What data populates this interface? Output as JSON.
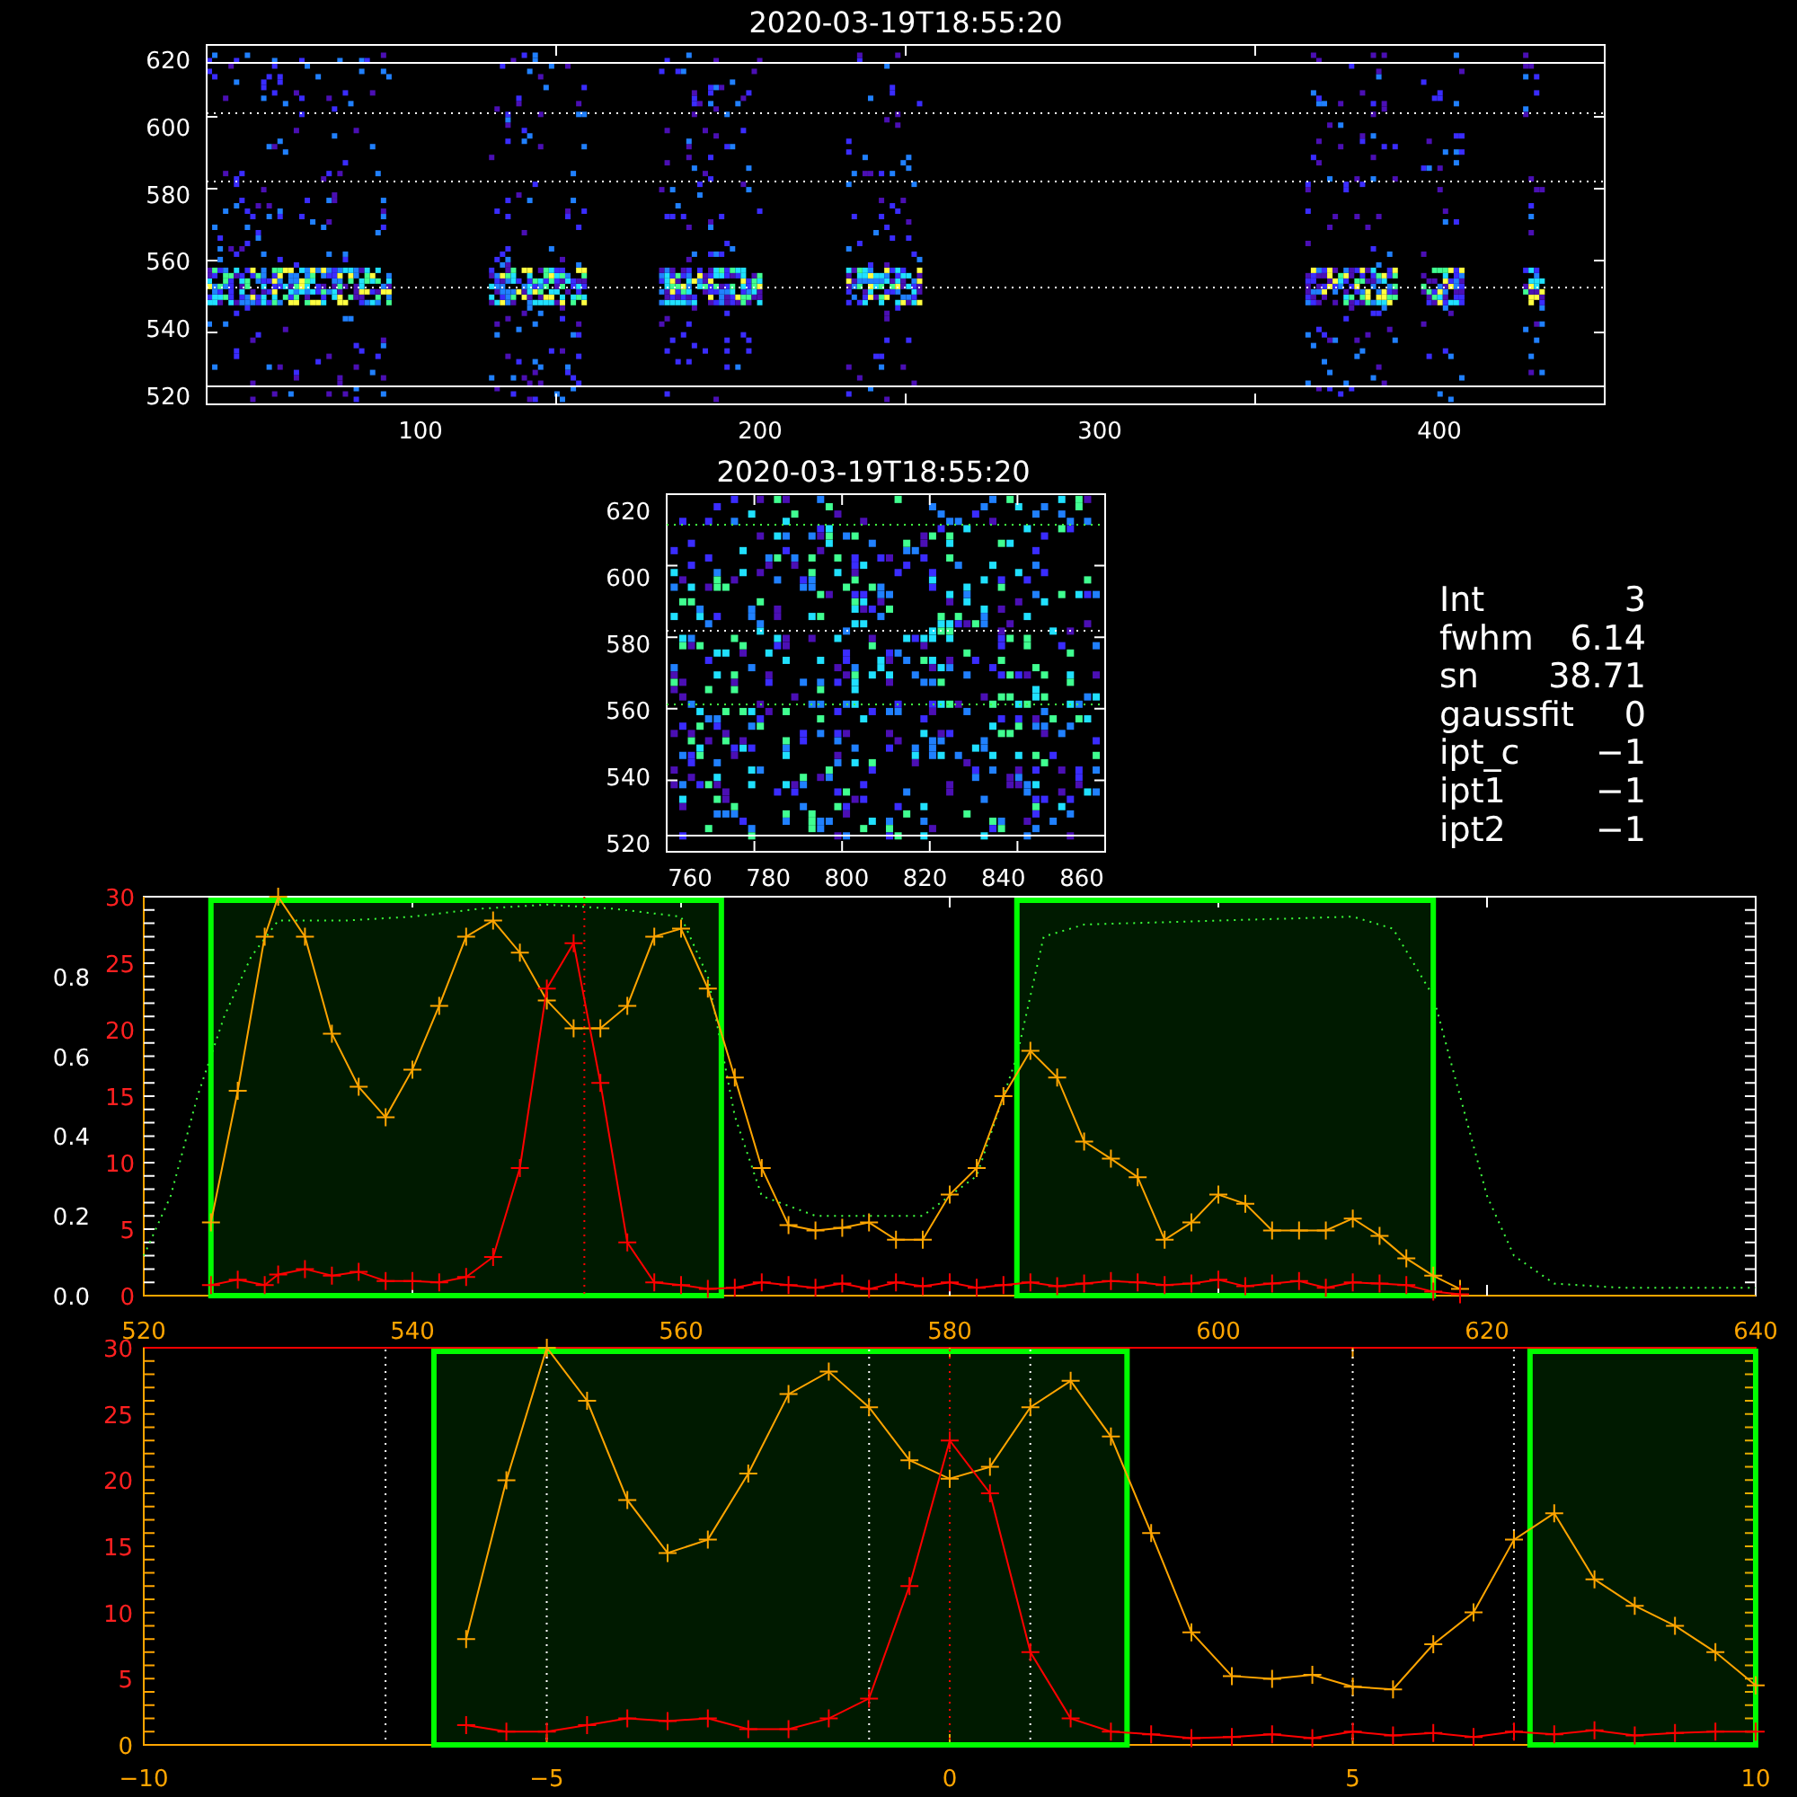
{
  "detector_image": {
    "title": "2020-03-19T18:55:20",
    "yticks": [
      "620",
      "600",
      "580",
      "560",
      "540",
      "520"
    ],
    "xticks": [
      "100",
      "200",
      "300",
      "400"
    ]
  },
  "zoom_image": {
    "title": "2020-03-19T18:55:20",
    "yticks": [
      "620",
      "600",
      "580",
      "560",
      "540",
      "520"
    ],
    "xticks": [
      "760",
      "780",
      "800",
      "820",
      "840",
      "860"
    ]
  },
  "fit_info": [
    {
      "label": "Int",
      "value": "3"
    },
    {
      "label": "fwhm",
      "value": "6.14"
    },
    {
      "label": "sn",
      "value": "38.71"
    },
    {
      "label": "gaussfit",
      "value": "0"
    },
    {
      "label": "ipt_c",
      "value": "−1"
    },
    {
      "label": "ipt1",
      "value": "−1"
    },
    {
      "label": "ipt2",
      "value": "−1"
    }
  ],
  "spectrum_plot": {
    "chart_data": {
      "type": "line",
      "xlim": [
        520,
        640
      ],
      "ylim": [
        0,
        30
      ],
      "xticks": [
        520,
        540,
        560,
        580,
        600,
        620,
        640
      ],
      "yticks": [
        0,
        5,
        10,
        15,
        20,
        25,
        30
      ],
      "x": [
        525,
        527,
        529,
        530,
        532,
        534,
        536,
        538,
        540,
        542,
        544,
        546,
        548,
        550,
        552,
        554,
        556,
        558,
        560,
        562,
        564,
        566,
        568,
        570,
        572,
        574,
        576,
        578,
        580,
        582,
        584,
        586,
        588,
        590,
        592,
        594,
        596,
        598,
        600,
        602,
        604,
        606,
        608,
        610,
        612,
        614,
        616,
        618
      ],
      "series": [
        {
          "color": "#ffa500",
          "marker": "cross",
          "values": [
            5.5,
            15.4,
            27,
            30,
            27,
            19.7,
            15.7,
            13.4,
            17,
            21.8,
            27,
            28.2,
            25.8,
            22.2,
            20.1,
            20.1,
            21.8,
            27,
            27.6,
            23.1,
            16.4,
            9.6,
            5.3,
            4.9,
            5.1,
            5.5,
            4.2,
            4.2,
            7.6,
            9.6,
            15,
            18.4,
            16.4,
            11.6,
            10.3,
            8.9,
            4.2,
            5.5,
            7.6,
            6.9,
            4.9,
            4.9,
            4.9,
            5.8,
            4.5,
            2.8,
            1.5,
            0.5
          ]
        },
        {
          "color": "#ff0000",
          "marker": "cross",
          "values": [
            0.8,
            1.2,
            0.8,
            1.6,
            2,
            1.5,
            1.8,
            1.1,
            1.1,
            1,
            1.4,
            2.9,
            9.6,
            23.1,
            26.5,
            16,
            4,
            1,
            0.8,
            0.5,
            0.6,
            1,
            0.8,
            0.6,
            0.9,
            0.5,
            1,
            0.7,
            1,
            0.6,
            0.8,
            1,
            0.7,
            0.9,
            1.1,
            1,
            0.8,
            0.9,
            1.2,
            0.7,
            0.9,
            1.1,
            0.6,
            1,
            0.9,
            0.8,
            0.3,
            0.1
          ]
        }
      ],
      "bands": [
        {
          "axis": "x",
          "from": 525,
          "to": 563,
          "color": "#00ff00"
        },
        {
          "axis": "x",
          "from": 585,
          "to": 616,
          "color": "#00ff00"
        }
      ],
      "ref_lines": [
        {
          "axis": "x",
          "value": 552.8,
          "color": "#ff0000"
        }
      ]
    }
  },
  "transmission_plot": {
    "chart_data": {
      "type": "line",
      "xlim": [
        520,
        640
      ],
      "ylim": [
        0,
        1
      ],
      "yticks": [
        {
          "value": 0,
          "label": "0.0"
        },
        {
          "value": 0.2,
          "label": "0.2"
        },
        {
          "value": 0.4,
          "label": "0.4"
        },
        {
          "value": 0.6,
          "label": "0.6"
        },
        {
          "value": 0.8,
          "label": "0.8"
        }
      ],
      "x": [
        520,
        522,
        524,
        526,
        528,
        530,
        535,
        540,
        545,
        550,
        555,
        560,
        562,
        564,
        566,
        570,
        578,
        582,
        585,
        587,
        590,
        600,
        610,
        613,
        616,
        618,
        620,
        622,
        625,
        630,
        640
      ],
      "series": [
        {
          "color": "#40ff40",
          "line_style": "dotted",
          "values": [
            0.1,
            0.25,
            0.5,
            0.7,
            0.85,
            0.94,
            0.94,
            0.95,
            0.97,
            0.98,
            0.97,
            0.95,
            0.8,
            0.45,
            0.25,
            0.2,
            0.2,
            0.3,
            0.6,
            0.9,
            0.93,
            0.94,
            0.95,
            0.92,
            0.75,
            0.5,
            0.25,
            0.1,
            0.03,
            0.02,
            0.02
          ]
        }
      ]
    }
  },
  "offset_plot": {
    "chart_data": {
      "type": "line",
      "xlim": [
        -10,
        10
      ],
      "ylim": [
        0,
        30
      ],
      "xticks": [
        {
          "value": -10,
          "label": "−10"
        },
        {
          "value": -5,
          "label": "−5"
        },
        0,
        5,
        10
      ],
      "yticks": [
        0,
        5,
        10,
        15,
        20,
        25,
        30
      ],
      "x": [
        -6,
        -5.5,
        -5,
        -4.5,
        -4,
        -3.5,
        -3,
        -2.5,
        -2,
        -1.5,
        -1,
        -0.5,
        0,
        0.5,
        1,
        1.5,
        2,
        2.5,
        3,
        3.5,
        4,
        4.5,
        5,
        5.5,
        6,
        6.5,
        7,
        7.5,
        8,
        8.5,
        9,
        9.5,
        10
      ],
      "series": [
        {
          "color": "#ffa500",
          "marker": "cross",
          "values": [
            8,
            20,
            30,
            26,
            18.5,
            14.5,
            15.5,
            20.5,
            26.5,
            28.2,
            25.5,
            21.5,
            20.1,
            21,
            25.5,
            27.5,
            23.3,
            16,
            8.5,
            5.2,
            5,
            5.3,
            4.4,
            4.2,
            7.6,
            10,
            15.5,
            17.5,
            12.5,
            10.5,
            9,
            7,
            4.5
          ]
        },
        {
          "color": "#ff0000",
          "marker": "cross",
          "values": [
            1.5,
            1,
            1,
            1.5,
            2,
            1.8,
            2,
            1.2,
            1.2,
            2,
            3.5,
            12,
            23,
            19,
            7,
            2,
            1,
            0.8,
            0.5,
            0.6,
            0.8,
            0.5,
            1,
            0.7,
            0.9,
            0.6,
            1,
            0.8,
            1.1,
            0.7,
            0.9,
            1,
            1
          ]
        }
      ],
      "bands": [
        {
          "axis": "x",
          "from": -6.4,
          "to": 2.2,
          "color": "#00ff00"
        },
        {
          "axis": "x",
          "from": 7.2,
          "to": 10,
          "color": "#00ff00"
        }
      ],
      "ref_lines": [
        {
          "axis": "x",
          "value": -7,
          "color": "#ffffff"
        },
        {
          "axis": "x",
          "value": -5,
          "color": "#ffffff"
        },
        {
          "axis": "x",
          "value": -1,
          "color": "#ffffff"
        },
        {
          "axis": "x",
          "value": 1,
          "color": "#ffffff"
        },
        {
          "axis": "x",
          "value": 5,
          "color": "#ffffff"
        },
        {
          "axis": "x",
          "value": 7,
          "color": "#ffffff"
        },
        {
          "axis": "x",
          "value": 0,
          "color": "#ff0000"
        }
      ]
    }
  }
}
